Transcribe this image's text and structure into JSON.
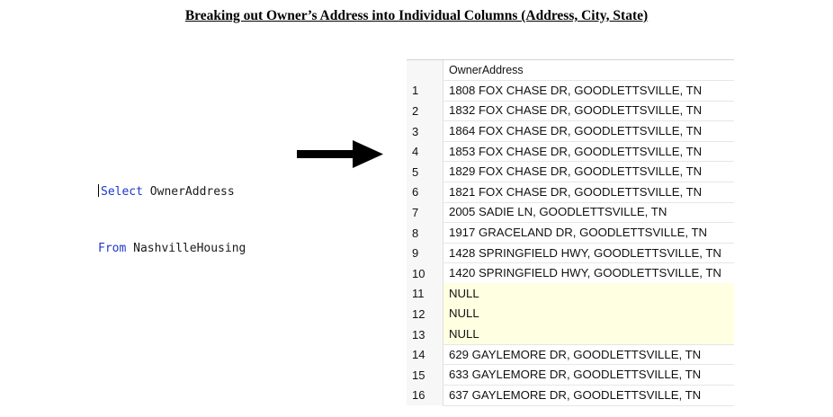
{
  "title": "Breaking out Owner’s Address into Individual Columns (Address, City, State)",
  "query": {
    "line1_keyword": "Select",
    "line1_identifier": " OwnerAddress",
    "line2_keyword": "From",
    "line2_identifier": " NashvilleHousing"
  },
  "results": {
    "column_header": "OwnerAddress",
    "rows": [
      {
        "num": "1",
        "value": "1808  FOX CHASE DR, GOODLETTSVILLE, TN",
        "is_null": false
      },
      {
        "num": "2",
        "value": "1832  FOX CHASE DR, GOODLETTSVILLE, TN",
        "is_null": false
      },
      {
        "num": "3",
        "value": "1864  FOX CHASE DR, GOODLETTSVILLE, TN",
        "is_null": false
      },
      {
        "num": "4",
        "value": "1853  FOX CHASE DR, GOODLETTSVILLE, TN",
        "is_null": false
      },
      {
        "num": "5",
        "value": "1829  FOX CHASE DR, GOODLETTSVILLE, TN",
        "is_null": false
      },
      {
        "num": "6",
        "value": "1821  FOX CHASE DR, GOODLETTSVILLE, TN",
        "is_null": false
      },
      {
        "num": "7",
        "value": "2005  SADIE LN, GOODLETTSVILLE, TN",
        "is_null": false
      },
      {
        "num": "8",
        "value": "1917  GRACELAND DR, GOODLETTSVILLE, TN",
        "is_null": false
      },
      {
        "num": "9",
        "value": "1428  SPRINGFIELD HWY, GOODLETTSVILLE, TN",
        "is_null": false
      },
      {
        "num": "10",
        "value": "1420  SPRINGFIELD HWY, GOODLETTSVILLE, TN",
        "is_null": false
      },
      {
        "num": "11",
        "value": "NULL",
        "is_null": true
      },
      {
        "num": "12",
        "value": "NULL",
        "is_null": true
      },
      {
        "num": "13",
        "value": "NULL",
        "is_null": true
      },
      {
        "num": "14",
        "value": "629  GAYLEMORE DR, GOODLETTSVILLE, TN",
        "is_null": false
      },
      {
        "num": "15",
        "value": "633  GAYLEMORE DR, GOODLETTSVILLE, TN",
        "is_null": false
      },
      {
        "num": "16",
        "value": "637  GAYLEMORE DR, GOODLETTSVILLE, TN",
        "is_null": false
      }
    ]
  },
  "colors": {
    "keyword": "#1b38c9",
    "null_highlight": "#ffffe1"
  },
  "icons": {
    "arrow": "right-arrow-icon"
  }
}
